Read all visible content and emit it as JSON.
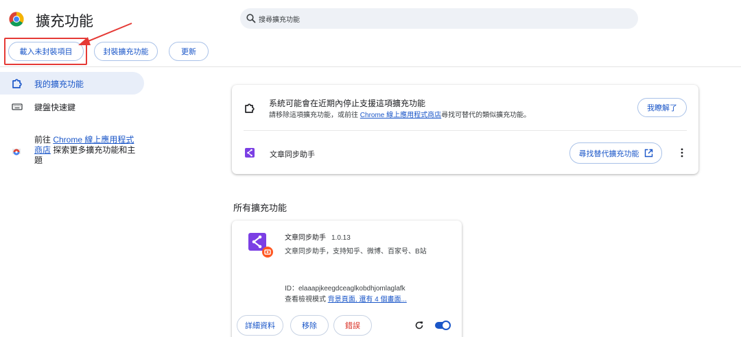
{
  "header": {
    "title": "擴充功能",
    "search_placeholder": "搜尋擴充功能"
  },
  "toolbar": {
    "load_unpacked": "載入未封裝項目",
    "pack_extension": "封裝擴充功能",
    "update": "更新"
  },
  "sidebar": {
    "items": [
      {
        "label": "我的擴充功能",
        "icon": "puzzle-icon",
        "active": true
      },
      {
        "label": "鍵盤快速鍵",
        "icon": "keyboard-icon",
        "active": false
      }
    ],
    "store_prefix": "前往 ",
    "store_link": "Chrome 線上應用程式商店",
    "store_suffix": " 探索更多擴充功能和主題"
  },
  "warning": {
    "title": "系統可能會在近期內停止支援這項擴充功能",
    "desc_prefix": "請移除這項擴充功能，或前往 ",
    "desc_link": "Chrome 線上應用程式商店",
    "desc_suffix": "尋找可替代的類似擴充功能。",
    "got_it": "我瞭解了",
    "extension_name": "文章同步助手",
    "find_alternative": "尋找替代擴充功能"
  },
  "all_extensions": {
    "title": "所有擴充功能",
    "extensions": [
      {
        "name": "文章同步助手",
        "version": "1.0.13",
        "description": "文章同步助手，支持知乎、微博、百家号、B站",
        "id": "ID：elaaapjkeegdceaglkobdhjomlaglafk",
        "inspect_prefix": "查看檢視模式 ",
        "inspect_link": "背景頁面, 還有 4 個畫面...",
        "details": "詳細資料",
        "remove": "移除",
        "errors": "錯誤",
        "enabled": true
      }
    ]
  },
  "colors": {
    "accent": "#1a56c8",
    "error": "#d93025",
    "annotation": "#e53935",
    "extension_purple": "#7b3fe4",
    "badge_orange": "#ff5722"
  }
}
